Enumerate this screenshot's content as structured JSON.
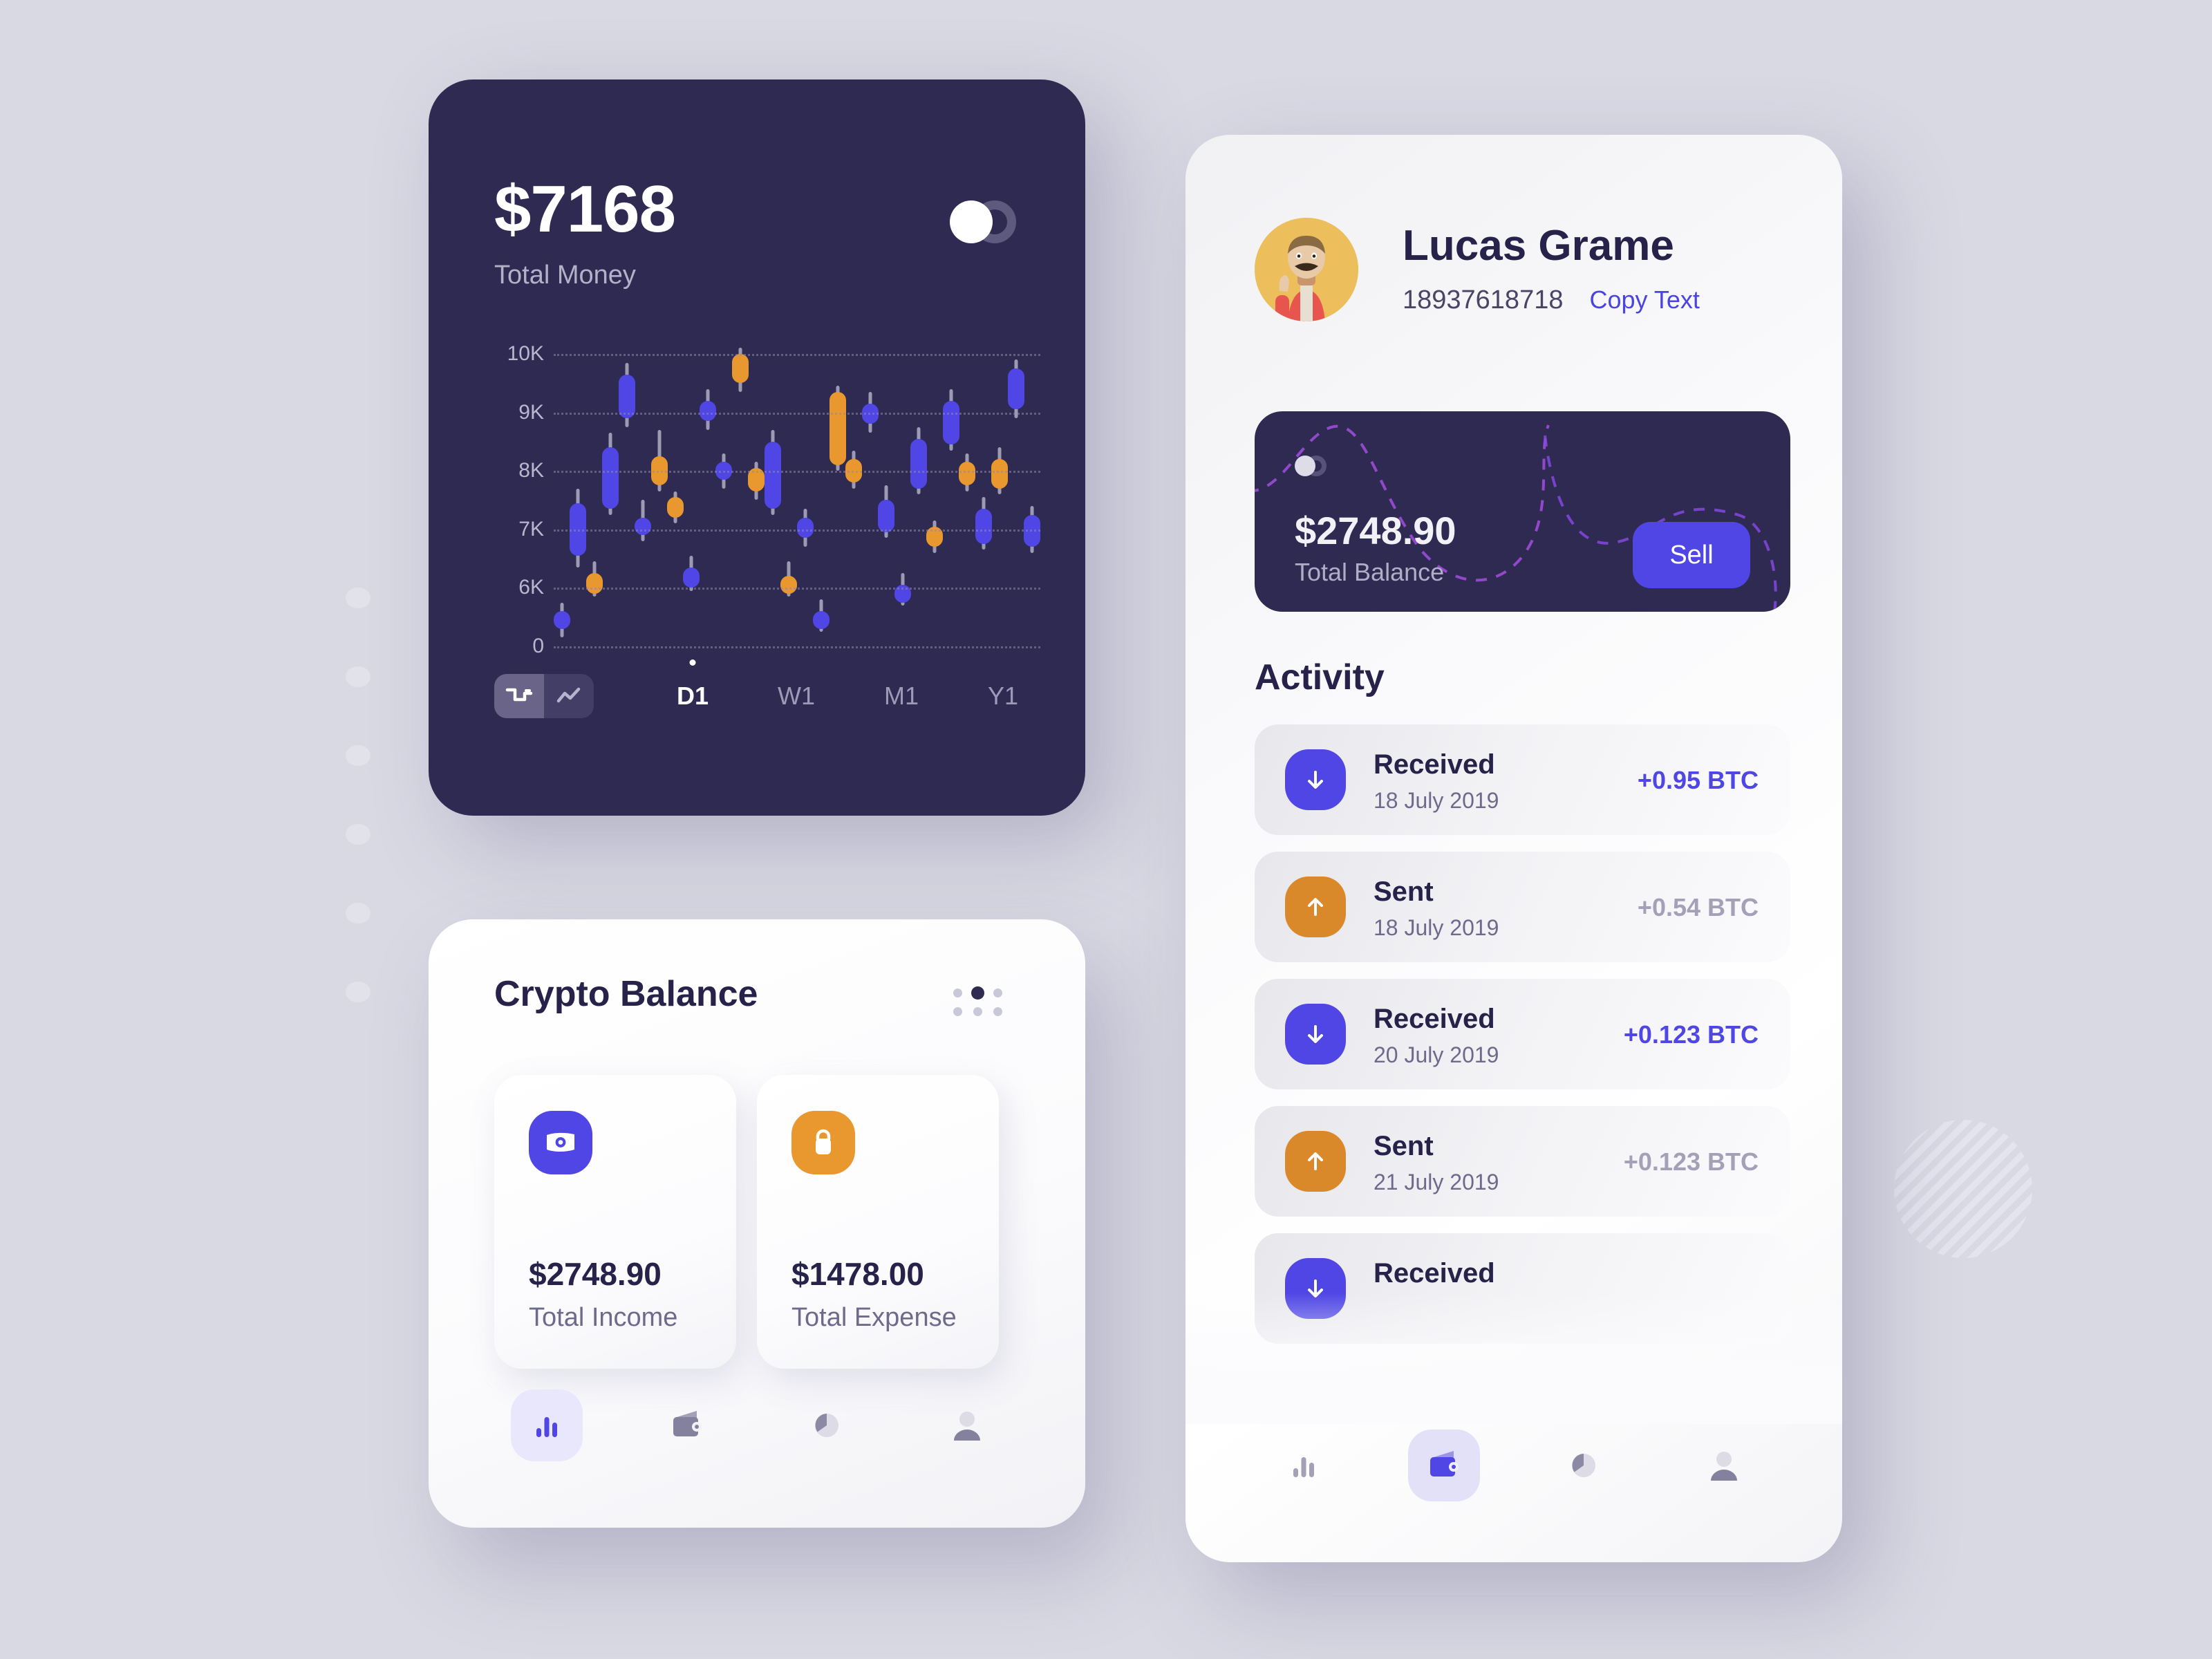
{
  "left_phone": {
    "total_amount": "$7168",
    "total_label": "Total Money",
    "toggle_name": "dark-mode-toggle",
    "chart_controls": {
      "type_buttons": [
        {
          "name": "candlestick-chart-icon",
          "active": true
        },
        {
          "name": "line-chart-icon",
          "active": false
        }
      ],
      "timeframes": [
        {
          "label": "D1",
          "active": true
        },
        {
          "label": "W1",
          "active": false
        },
        {
          "label": "M1",
          "active": false
        },
        {
          "label": "Y1",
          "active": false
        }
      ]
    },
    "sheet": {
      "title": "Crypto Balance",
      "menu_icon": "dot-grid-menu-icon",
      "stats": [
        {
          "value": "$2748.90",
          "label": "Total Income",
          "icon": "banknote-icon",
          "color": "#4f46e5"
        },
        {
          "value": "$1478.00",
          "label": "Total Expense",
          "icon": "bag-icon",
          "color": "#e8982e"
        }
      ]
    },
    "bottom_nav": [
      {
        "name": "bar-chart-icon",
        "active": true
      },
      {
        "name": "wallet-icon",
        "active": false
      },
      {
        "name": "pie-chart-icon",
        "active": false
      },
      {
        "name": "profile-icon",
        "active": false
      }
    ]
  },
  "right_phone": {
    "profile": {
      "avatar": "avatar-illustration",
      "name": "Lucas Grame",
      "phone": "18937618718",
      "copy_label": "Copy Text"
    },
    "balance_card": {
      "amount": "$2748.90",
      "label": "Total Balance",
      "sell_label": "Sell",
      "toggle_name": "balance-visibility-toggle"
    },
    "activity": {
      "title": "Activity",
      "items": [
        {
          "type": "Received",
          "date": "18 July 2019",
          "amount": "+0.95 BTC",
          "direction": "down",
          "color": "#4f46e5",
          "amount_color": "#4f46e5"
        },
        {
          "type": "Sent",
          "date": "18 July 2019",
          "amount": "+0.54 BTC",
          "direction": "up",
          "color": "#d9882a",
          "amount_color": "#a3a0b8"
        },
        {
          "type": "Received",
          "date": "20 July 2019",
          "amount": "+0.123 BTC",
          "direction": "down",
          "color": "#4f46e5",
          "amount_color": "#4f46e5"
        },
        {
          "type": "Sent",
          "date": "21 July 2019",
          "amount": "+0.123 BTC",
          "direction": "up",
          "color": "#d9882a",
          "amount_color": "#a3a0b8"
        },
        {
          "type": "Received",
          "date": "",
          "amount": "",
          "direction": "down",
          "color": "#4f46e5",
          "amount_color": "#4f46e5"
        }
      ]
    },
    "bottom_nav": [
      {
        "name": "bar-chart-icon",
        "active": false
      },
      {
        "name": "wallet-icon",
        "active": true
      },
      {
        "name": "pie-chart-icon",
        "active": false
      },
      {
        "name": "profile-icon",
        "active": false
      }
    ]
  },
  "theme": {
    "background": "#d9d9e4",
    "dark_navy": "#2f2a52",
    "accent_indigo": "#4f46e5",
    "accent_orange": "#e8982e",
    "muted_text": "#6e6a8c"
  },
  "chart_data": {
    "type": "candlestick",
    "title": "",
    "xlabel": "",
    "ylabel": "",
    "ylim": [
      5000,
      10000
    ],
    "y_ticks": [
      "0",
      "6K",
      "7K",
      "8K",
      "9K",
      "10K"
    ],
    "y_tick_values": [
      5000,
      6000,
      7000,
      8000,
      9000,
      10000
    ],
    "grid": true,
    "legend": null,
    "colors": {
      "up": "#4f46e5",
      "down": "#e8982e"
    },
    "candles": [
      {
        "i": 0,
        "open": 5600,
        "close": 5300,
        "high": 5750,
        "low": 5150,
        "dir": "up"
      },
      {
        "i": 1,
        "open": 7450,
        "close": 6550,
        "high": 7700,
        "low": 6350,
        "dir": "up"
      },
      {
        "i": 2,
        "open": 6250,
        "close": 5900,
        "high": 6450,
        "low": 5850,
        "dir": "down"
      },
      {
        "i": 3,
        "open": 8400,
        "close": 7350,
        "high": 8650,
        "low": 7250,
        "dir": "up"
      },
      {
        "i": 4,
        "open": 9650,
        "close": 8900,
        "high": 9850,
        "low": 8750,
        "dir": "up"
      },
      {
        "i": 5,
        "open": 7200,
        "close": 6900,
        "high": 7500,
        "low": 6800,
        "dir": "up"
      },
      {
        "i": 6,
        "open": 8250,
        "close": 7750,
        "high": 8700,
        "low": 7650,
        "dir": "down"
      },
      {
        "i": 7,
        "open": 7550,
        "close": 7200,
        "high": 7650,
        "low": 7100,
        "dir": "down"
      },
      {
        "i": 8,
        "open": 6350,
        "close": 6000,
        "high": 6550,
        "low": 5950,
        "dir": "up"
      },
      {
        "i": 9,
        "open": 9200,
        "close": 8850,
        "high": 9400,
        "low": 8700,
        "dir": "up"
      },
      {
        "i": 10,
        "open": 8150,
        "close": 7850,
        "high": 8300,
        "low": 7700,
        "dir": "up"
      },
      {
        "i": 11,
        "open": 10000,
        "close": 9500,
        "high": 10100,
        "low": 9350,
        "dir": "down"
      },
      {
        "i": 12,
        "open": 8050,
        "close": 7650,
        "high": 8150,
        "low": 7500,
        "dir": "down"
      },
      {
        "i": 13,
        "open": 8500,
        "close": 7350,
        "high": 8700,
        "low": 7250,
        "dir": "up"
      },
      {
        "i": 14,
        "open": 6200,
        "close": 5900,
        "high": 6450,
        "low": 5850,
        "dir": "down"
      },
      {
        "i": 15,
        "open": 7200,
        "close": 6850,
        "high": 7350,
        "low": 6700,
        "dir": "up"
      },
      {
        "i": 16,
        "open": 5600,
        "close": 5300,
        "high": 5800,
        "low": 5250,
        "dir": "up"
      },
      {
        "i": 17,
        "open": 9350,
        "close": 8100,
        "high": 9450,
        "low": 8000,
        "dir": "down"
      },
      {
        "i": 18,
        "open": 8200,
        "close": 7800,
        "high": 8350,
        "low": 7700,
        "dir": "down"
      },
      {
        "i": 19,
        "open": 9150,
        "close": 8800,
        "high": 9350,
        "low": 8650,
        "dir": "up"
      },
      {
        "i": 20,
        "open": 7500,
        "close": 6950,
        "high": 7750,
        "low": 6850,
        "dir": "up"
      },
      {
        "i": 21,
        "open": 6050,
        "close": 5750,
        "high": 6250,
        "low": 5700,
        "dir": "up"
      },
      {
        "i": 22,
        "open": 8550,
        "close": 7700,
        "high": 8750,
        "low": 7600,
        "dir": "up"
      },
      {
        "i": 23,
        "open": 7050,
        "close": 6700,
        "high": 7150,
        "low": 6600,
        "dir": "down"
      },
      {
        "i": 24,
        "open": 9200,
        "close": 8450,
        "high": 9400,
        "low": 8350,
        "dir": "up"
      },
      {
        "i": 25,
        "open": 8150,
        "close": 7750,
        "high": 8300,
        "low": 7650,
        "dir": "down"
      },
      {
        "i": 26,
        "open": 7350,
        "close": 6750,
        "high": 7550,
        "low": 6650,
        "dir": "up"
      },
      {
        "i": 27,
        "open": 8200,
        "close": 7700,
        "high": 8400,
        "low": 7600,
        "dir": "down"
      },
      {
        "i": 28,
        "open": 9750,
        "close": 9050,
        "high": 9900,
        "low": 8900,
        "dir": "up"
      },
      {
        "i": 29,
        "open": 7250,
        "close": 6700,
        "high": 7400,
        "low": 6600,
        "dir": "up"
      }
    ]
  }
}
